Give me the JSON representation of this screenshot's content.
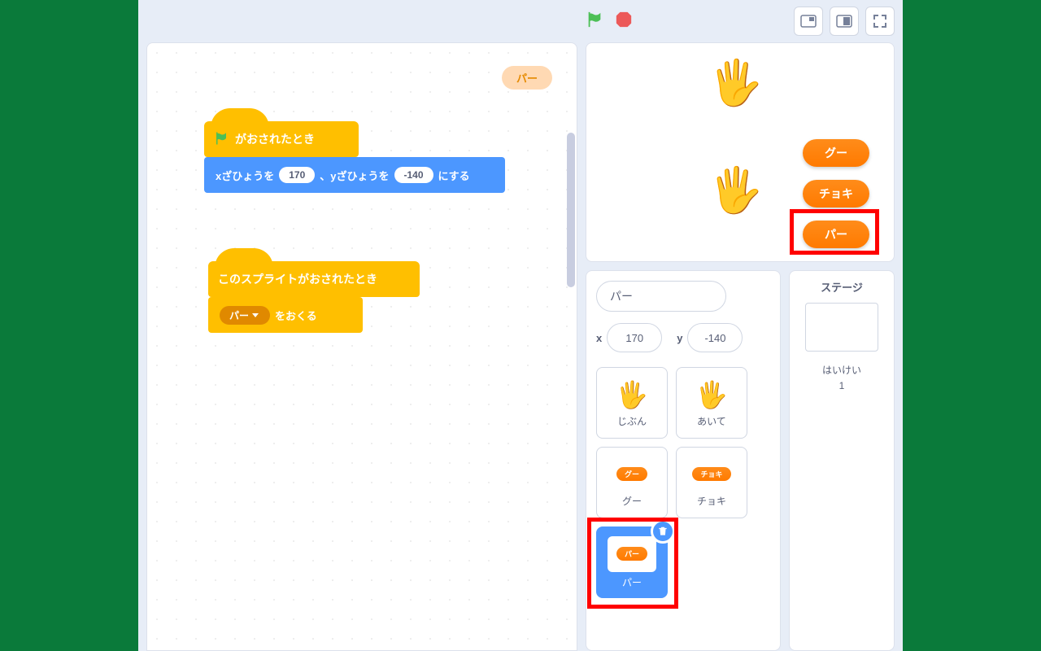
{
  "topbar": {
    "flag": "green-flag",
    "stop": "stop-sign"
  },
  "ghost_pill": "パー",
  "block1": {
    "hat_label": "がおされたとき",
    "motion_pre": "xざひょうを",
    "motion_x": "170",
    "motion_mid": "、yざひょうを",
    "motion_y": "-140",
    "motion_suf": "にする"
  },
  "block2": {
    "hat_label": "このスプライトがおされたとき",
    "send_dropdown": "パー",
    "send_suf": "をおくる"
  },
  "stage_buttons": {
    "rock": "グー",
    "scissors": "チョキ",
    "paper": "パー"
  },
  "sprite_info": {
    "name": "パー",
    "x_label": "x",
    "x": "170",
    "y_label": "y",
    "y": "-140"
  },
  "sprites": {
    "jibun": "じぶん",
    "aite": "あいて",
    "gu": "グー",
    "choki": "チョキ",
    "pa": "パー"
  },
  "stage_panel": {
    "title": "ステージ",
    "backdrop_label": "はいけい",
    "backdrop_count": "1"
  }
}
